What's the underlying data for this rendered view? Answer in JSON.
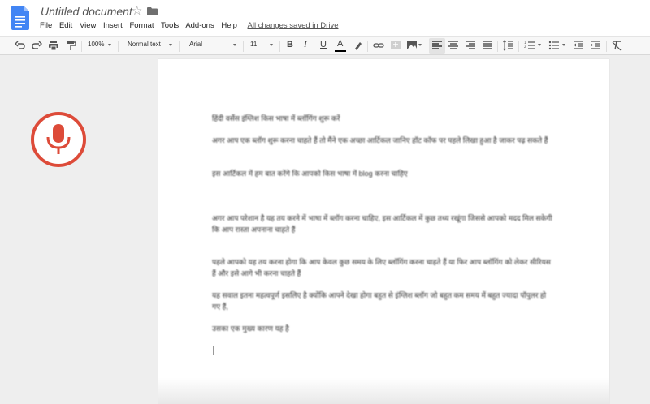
{
  "header": {
    "title": "Untitled document",
    "menu": [
      "File",
      "Edit",
      "View",
      "Insert",
      "Format",
      "Tools",
      "Add-ons",
      "Help"
    ],
    "saved_status": "All changes saved in Drive"
  },
  "toolbar": {
    "zoom": "100%",
    "style": "Normal text",
    "font": "Arial",
    "font_size": "11",
    "bold": "B",
    "italic": "I",
    "underline": "U",
    "text_color": "A"
  },
  "document": {
    "paragraphs": [
      "हिंदी वर्सेस इंग्लिश किस भाषा में ब्लॉगिंग शुरू करें",
      "अगर आप एक ब्लॉग शुरू करना चाहते हैं तो मैंने एक अच्छा आर्टिकल जानिए हॉट कॉफ पर पहले लिखा हुआ है जाकर पढ़ सकते हैं",
      "इस आर्टिकल में हम बात करेंगे कि आपको किस भाषा में blog करना चाहिए",
      "अगर आप परेशान है यह तय करने में भाषा में ब्लॉग करना चाहिए, इस आर्टिकल में कुछ तथ्य रखूंगा जिससे आपको मदद मिल सकेगी कि आप रास्ता अपनाना चाहते हैं",
      "पहले आपको यह तय करना होगा कि आप केवल कुछ समय के लिए ब्लॉगिंग करना चाहते हैं या फिर आप ब्लॉगिंग को लेकर सीरियस हैं और इसे आगे भी करना चाहते हैं",
      "यह सवाल इतना महत्वपूर्ण इसलिए है क्योंकि आपने देखा होगा बहुत से इंग्लिश ब्लॉग जो बहुत कम समय में बहुत ज्यादा पॉपुलर हो गए हैं,",
      "उसका एक मुख्य कारण यह है"
    ]
  },
  "colors": {
    "mic_accent": "#dd4b39",
    "doc_icon": "#4285f4"
  }
}
